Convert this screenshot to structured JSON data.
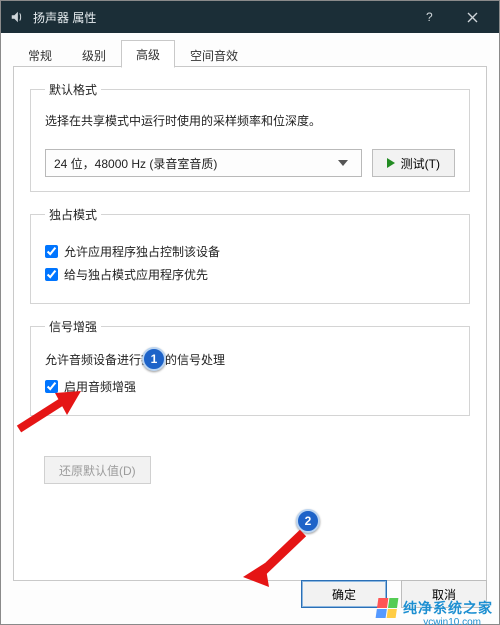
{
  "window": {
    "title": "扬声器 属性"
  },
  "tabs": {
    "items": [
      {
        "label": "常规"
      },
      {
        "label": "级别"
      },
      {
        "label": "高级"
      },
      {
        "label": "空间音效"
      }
    ],
    "selected_index": 2
  },
  "default_format": {
    "legend": "默认格式",
    "desc": "选择在共享模式中运行时使用的采样频率和位深度。",
    "selected": "24 位，48000 Hz (录音室音质)",
    "test_label": "测试(T)"
  },
  "exclusive": {
    "legend": "独占模式",
    "allow_exclusive": {
      "label": "允许应用程序独占控制该设备",
      "checked": true
    },
    "priority": {
      "label": "给与独占模式应用程序优先",
      "checked": true
    }
  },
  "enhance": {
    "legend": "信号增强",
    "desc": "允许音频设备进行额外的信号处理",
    "enable": {
      "label": "启用音频增强",
      "checked": true
    }
  },
  "buttons": {
    "restore": "还原默认值(D)",
    "ok": "确定",
    "cancel": "取消"
  },
  "annotations": {
    "marker1": "1",
    "marker2": "2"
  },
  "watermark": {
    "text": "纯净系统之家",
    "url": "ycwin10.com"
  }
}
